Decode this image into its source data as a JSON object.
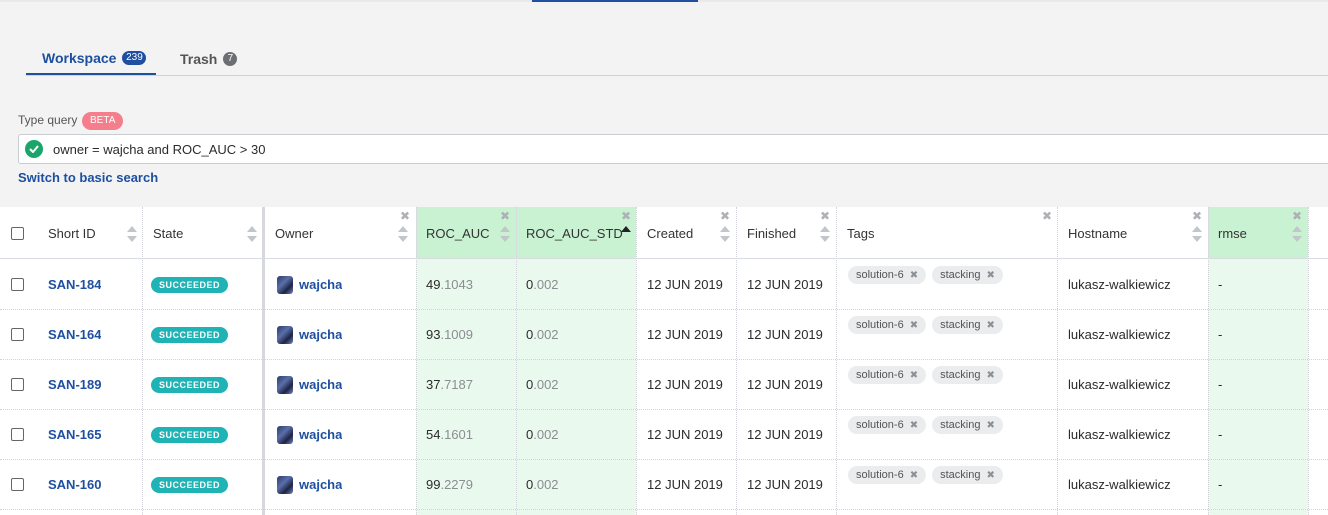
{
  "tabs": [
    {
      "label": "Workspace",
      "count": "239"
    },
    {
      "label": "Trash",
      "count": "7"
    }
  ],
  "query": {
    "label": "Type query",
    "beta": "BETA",
    "value": "owner = wajcha and ROC_AUC > 30",
    "switch_link": "Switch to basic search"
  },
  "table": {
    "headers": {
      "short_id": "Short ID",
      "state": "State",
      "owner": "Owner",
      "roc_auc": "ROC_AUC",
      "roc_auc_std": "ROC_AUC_STD",
      "created": "Created",
      "finished": "Finished",
      "tags": "Tags",
      "hostname": "Hostname",
      "rmse": "rmse"
    },
    "rows": [
      {
        "id": "SAN-184",
        "state": "SUCCEEDED",
        "owner": "wajcha",
        "roc_int": "49",
        "roc_frac": ".1043",
        "std_int": "0",
        "std_frac": ".002",
        "created": "12 JUN 2019",
        "finished": "12 JUN 2019",
        "tag1": "solution-6",
        "tag2": "stacking",
        "hostname": "lukasz-walkiewicz",
        "rmse": "-"
      },
      {
        "id": "SAN-164",
        "state": "SUCCEEDED",
        "owner": "wajcha",
        "roc_int": "93",
        "roc_frac": ".1009",
        "std_int": "0",
        "std_frac": ".002",
        "created": "12 JUN 2019",
        "finished": "12 JUN 2019",
        "tag1": "solution-6",
        "tag2": "stacking",
        "hostname": "lukasz-walkiewicz",
        "rmse": "-"
      },
      {
        "id": "SAN-189",
        "state": "SUCCEEDED",
        "owner": "wajcha",
        "roc_int": "37",
        "roc_frac": ".7187",
        "std_int": "0",
        "std_frac": ".002",
        "created": "12 JUN 2019",
        "finished": "12 JUN 2019",
        "tag1": "solution-6",
        "tag2": "stacking",
        "hostname": "lukasz-walkiewicz",
        "rmse": "-"
      },
      {
        "id": "SAN-165",
        "state": "SUCCEEDED",
        "owner": "wajcha",
        "roc_int": "54",
        "roc_frac": ".1601",
        "std_int": "0",
        "std_frac": ".002",
        "created": "12 JUN 2019",
        "finished": "12 JUN 2019",
        "tag1": "solution-6",
        "tag2": "stacking",
        "hostname": "lukasz-walkiewicz",
        "rmse": "-"
      },
      {
        "id": "SAN-160",
        "state": "SUCCEEDED",
        "owner": "wajcha",
        "roc_int": "99",
        "roc_frac": ".2279",
        "std_int": "0",
        "std_frac": ".002",
        "created": "12 JUN 2019",
        "finished": "12 JUN 2019",
        "tag1": "solution-6",
        "tag2": "stacking",
        "hostname": "lukasz-walkiewicz",
        "rmse": "-"
      }
    ]
  },
  "colors": {
    "accent": "#1e4fa0",
    "succeeded": "#1fb3b5",
    "beta": "#f57e8c",
    "highlight_column": "#eaf9ee",
    "query_valid": "#1aa66b"
  }
}
